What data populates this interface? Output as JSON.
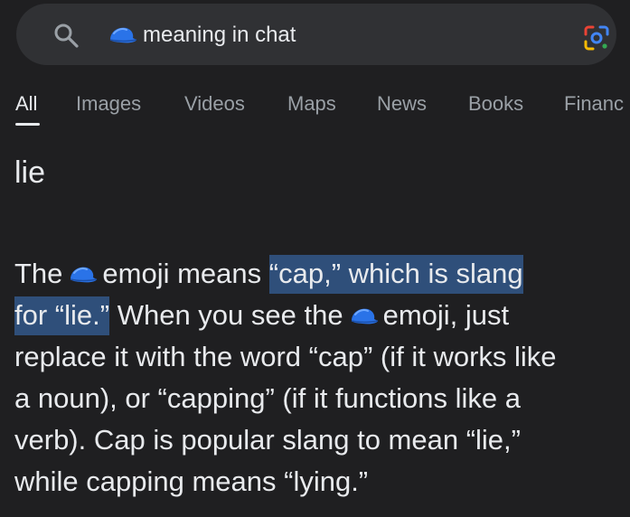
{
  "search": {
    "query": "meaning in chat",
    "query_emoji": "blue-cap-icon"
  },
  "tabs": [
    {
      "label": "All",
      "active": true
    },
    {
      "label": "Images"
    },
    {
      "label": "Videos"
    },
    {
      "label": "Maps"
    },
    {
      "label": "News"
    },
    {
      "label": "Books"
    },
    {
      "label": "Financ"
    }
  ],
  "result": {
    "title": "lie",
    "line1_a": "The",
    "line1_b": "emoji means",
    "line1_hl": "“cap,” which is slang",
    "line2_hl": "for “lie.”",
    "line2_a": "When you see the",
    "line2_b": "emoji, just",
    "line3": "replace it with the word “cap” (if it works like",
    "line4": "a noun), or “capping” (if it functions like a",
    "line5": "verb). Cap is popular slang to mean “lie,”",
    "line6": "while capping means “lying.”"
  },
  "colors": {
    "background": "#1f1f21",
    "search_bg": "#303134",
    "highlight": "#2f4f7a",
    "text": "#e8eaed",
    "muted": "#9aa0a6"
  }
}
